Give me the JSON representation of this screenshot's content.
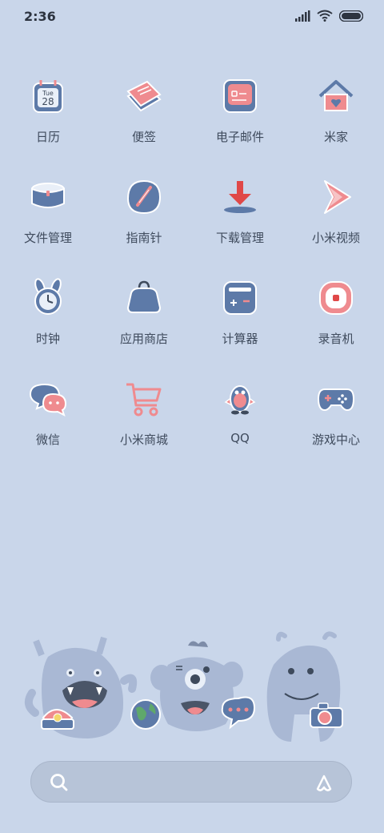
{
  "status": {
    "time": "2:36"
  },
  "apps": [
    [
      {
        "label": "日历",
        "icon": "calendar-icon",
        "date_day": "Tue",
        "date_num": "28"
      },
      {
        "label": "便签",
        "icon": "notes-icon"
      },
      {
        "label": "电子邮件",
        "icon": "email-icon"
      },
      {
        "label": "米家",
        "icon": "mi-home-icon"
      }
    ],
    [
      {
        "label": "文件管理",
        "icon": "file-manager-icon"
      },
      {
        "label": "指南针",
        "icon": "compass-icon"
      },
      {
        "label": "下载管理",
        "icon": "download-icon"
      },
      {
        "label": "小米视频",
        "icon": "video-icon"
      }
    ],
    [
      {
        "label": "时钟",
        "icon": "clock-icon"
      },
      {
        "label": "应用商店",
        "icon": "app-store-icon"
      },
      {
        "label": "计算器",
        "icon": "calculator-icon"
      },
      {
        "label": "录音机",
        "icon": "recorder-icon"
      }
    ],
    [
      {
        "label": "微信",
        "icon": "wechat-icon"
      },
      {
        "label": "小米商城",
        "icon": "mi-store-icon"
      },
      {
        "label": "QQ",
        "icon": "qq-icon"
      },
      {
        "label": "游戏中心",
        "icon": "game-center-icon"
      }
    ]
  ],
  "dock": [
    "phone-icon",
    "browser-icon",
    "messages-icon",
    "camera-icon"
  ],
  "colors": {
    "background": "#c9d6ea",
    "icon_blue": "#5d7aa8",
    "icon_pink": "#ef8b8f",
    "monster": "#a9b8d4"
  }
}
